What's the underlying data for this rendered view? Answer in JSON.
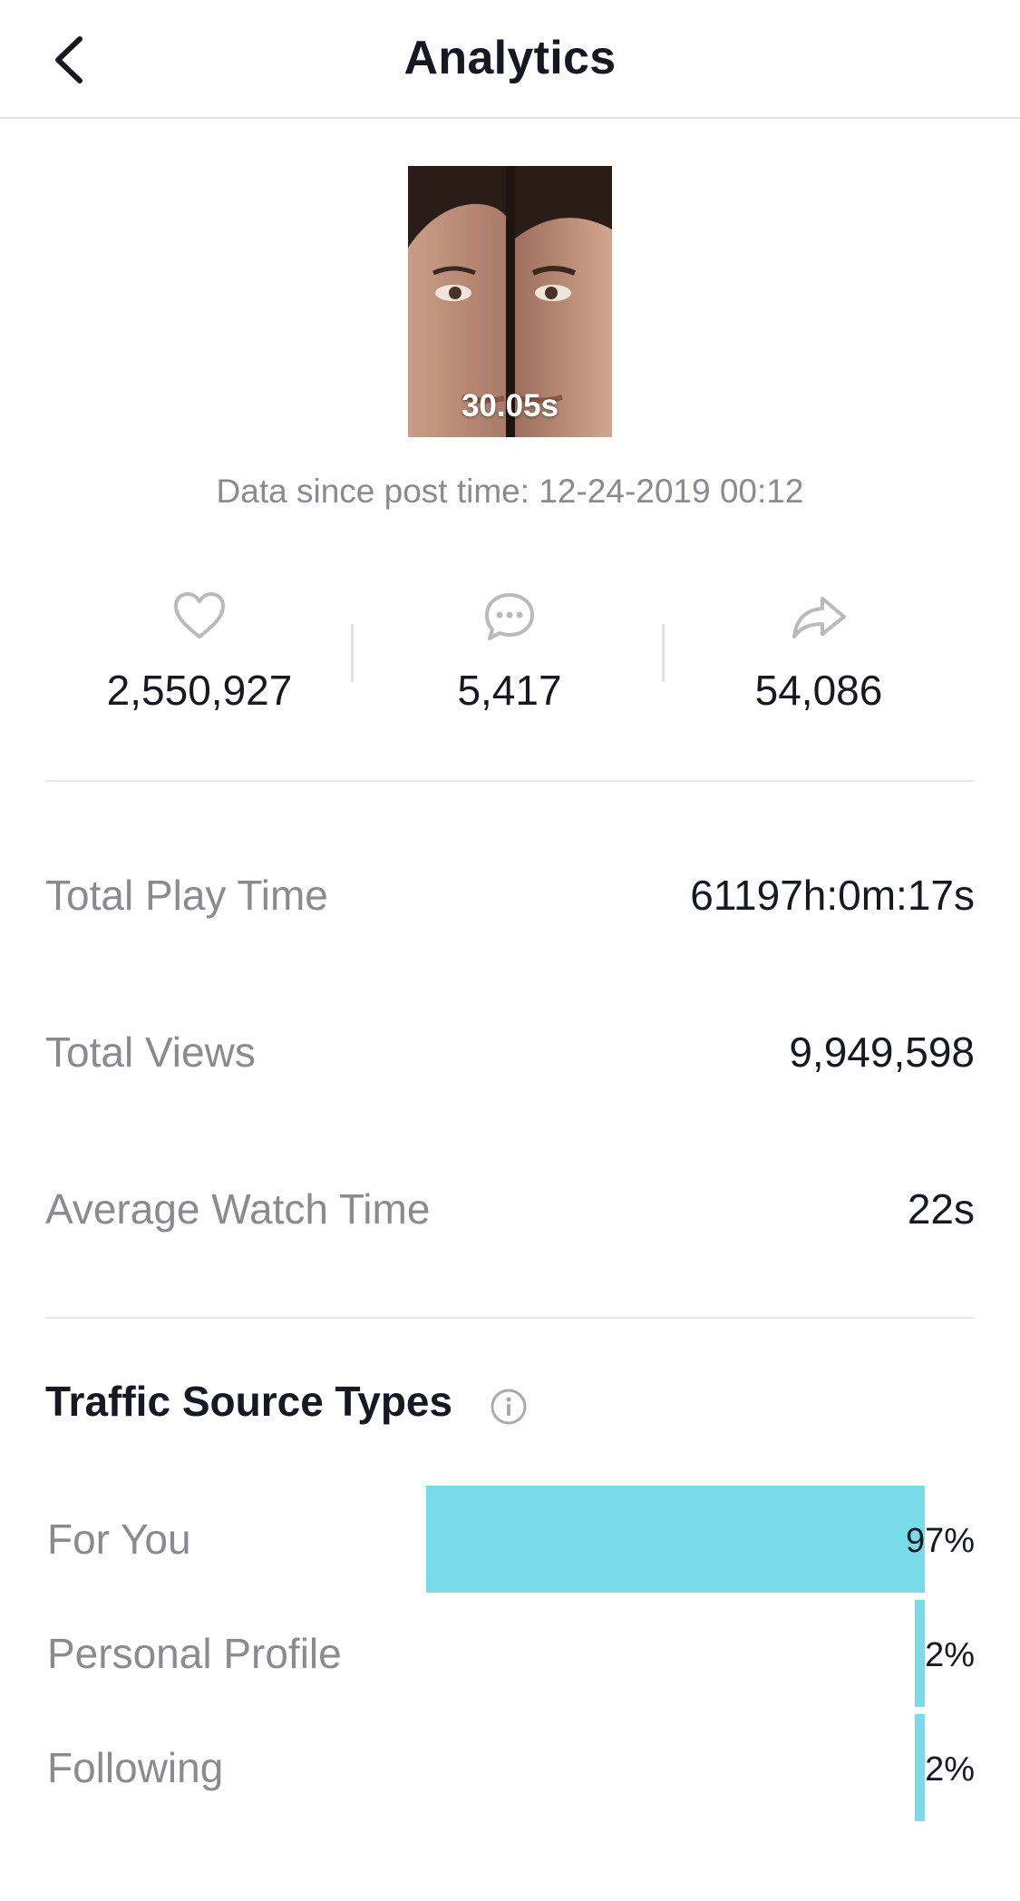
{
  "header": {
    "title": "Analytics",
    "back_icon": "chevron-left-icon"
  },
  "video": {
    "duration": "30.05s"
  },
  "since_text": "Data since post time: 12-24-2019 00:12",
  "stats": [
    {
      "icon": "heart-icon",
      "value": "2,550,927"
    },
    {
      "icon": "comment-icon",
      "value": "5,417"
    },
    {
      "icon": "share-icon",
      "value": "54,086"
    }
  ],
  "metrics": [
    {
      "label": "Total Play Time",
      "value": "61197h:0m:17s"
    },
    {
      "label": "Total Views",
      "value": "9,949,598"
    },
    {
      "label": "Average Watch Time",
      "value": "22s"
    }
  ],
  "traffic": {
    "title": "Traffic Source Types",
    "info_icon": "info-icon",
    "bar_color": "#78dbe9",
    "items": [
      {
        "label": "For You",
        "percent_text": "97%",
        "share": 0.97
      },
      {
        "label": "Personal Profile",
        "percent_text": "2%",
        "share": 0.02
      },
      {
        "label": "Following",
        "percent_text": "2%",
        "share": 0.02
      }
    ]
  }
}
